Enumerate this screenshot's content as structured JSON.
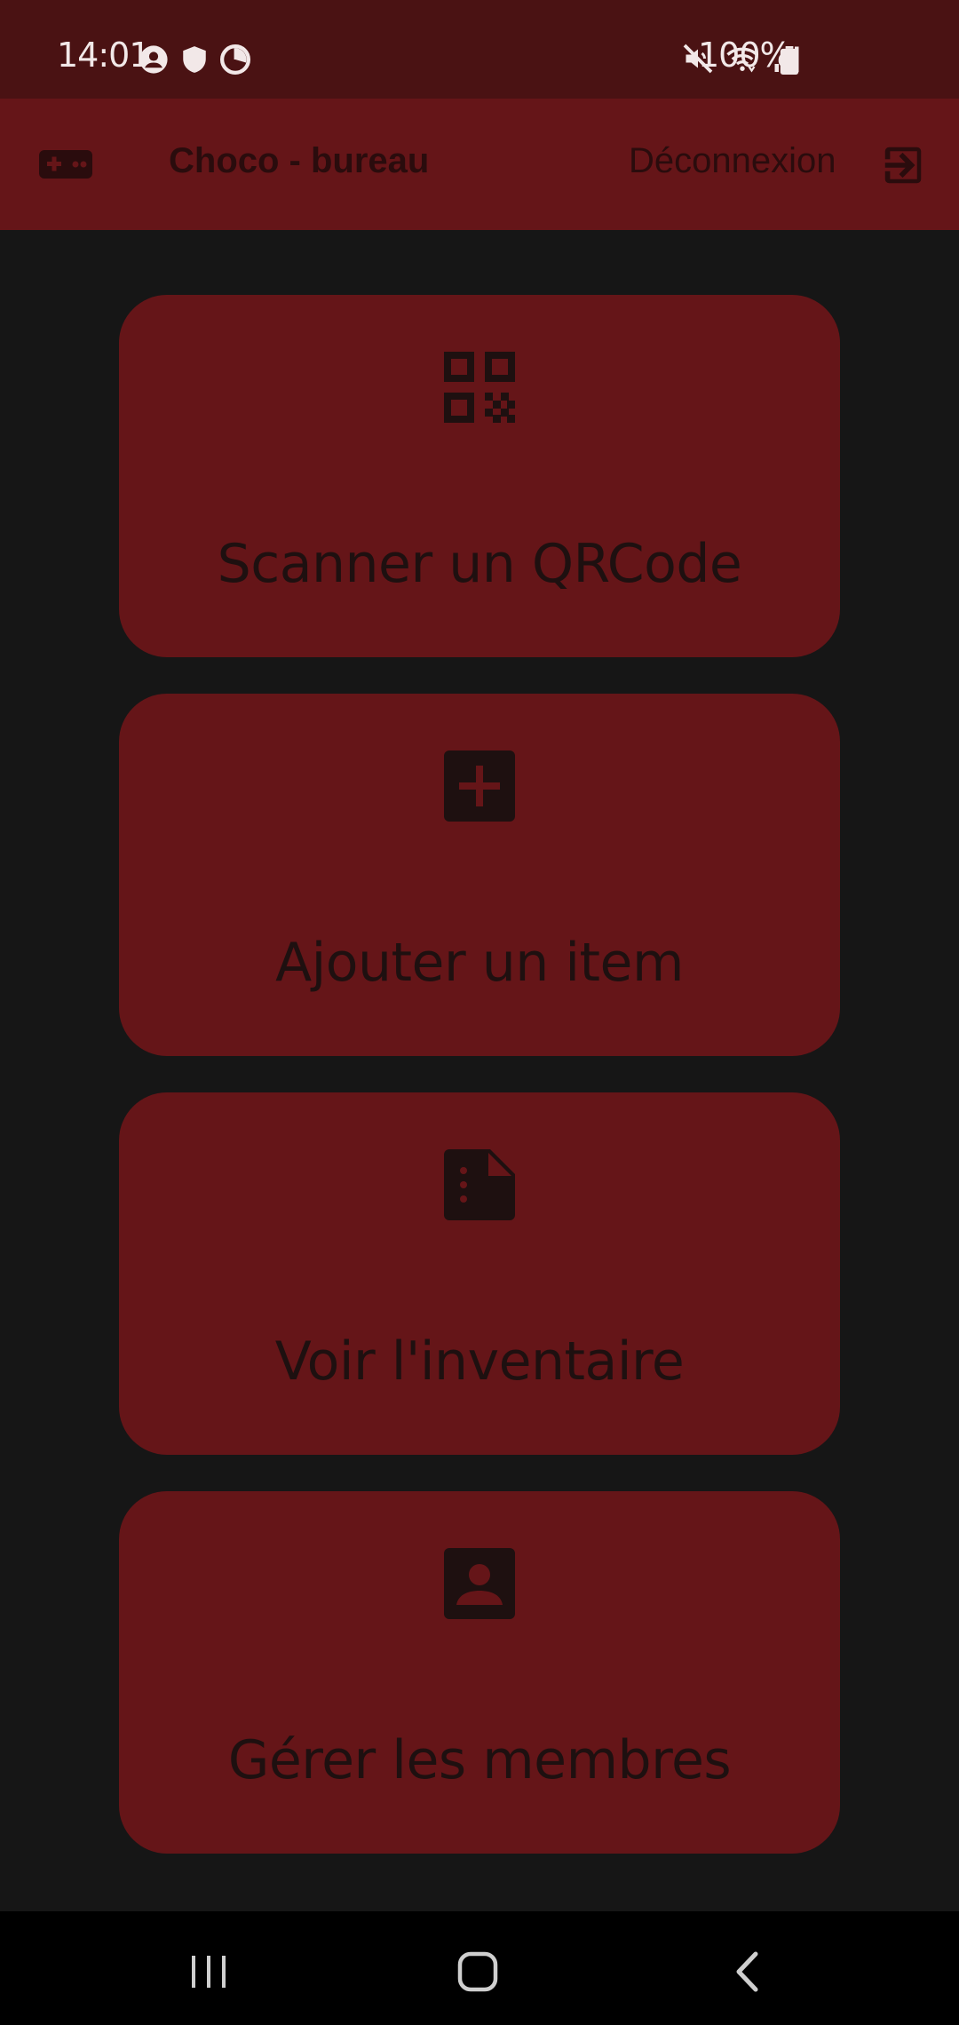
{
  "status_bar": {
    "time": "14:01",
    "battery_percent": "100%",
    "left_icons": [
      "account-circle-icon",
      "shield-icon",
      "data-saver-icon"
    ],
    "right_icons": [
      "mute-icon",
      "wifi-icon",
      "signal-icon",
      "battery-icon"
    ]
  },
  "app_bar": {
    "icon": "gamepad-icon",
    "title": "Choco - bureau",
    "logout_label": "Déconnexion",
    "logout_icon": "logout-icon"
  },
  "cards": [
    {
      "icon": "qr-code-icon",
      "label": "Scanner un QRCode"
    },
    {
      "icon": "add-box-icon",
      "label": "Ajouter un item"
    },
    {
      "icon": "document-list-icon",
      "label": "Voir l'inventaire"
    },
    {
      "icon": "contact-card-icon",
      "label": "Gérer les membres"
    }
  ],
  "nav_bar": {
    "buttons": [
      "recent-apps-icon",
      "home-icon",
      "back-icon"
    ]
  },
  "colors": {
    "status_bar": "#4a1213",
    "app_bar": "#651518",
    "card": "#651518",
    "background": "#161616",
    "card_text": "#1e1010",
    "nav_bar": "#000000"
  }
}
